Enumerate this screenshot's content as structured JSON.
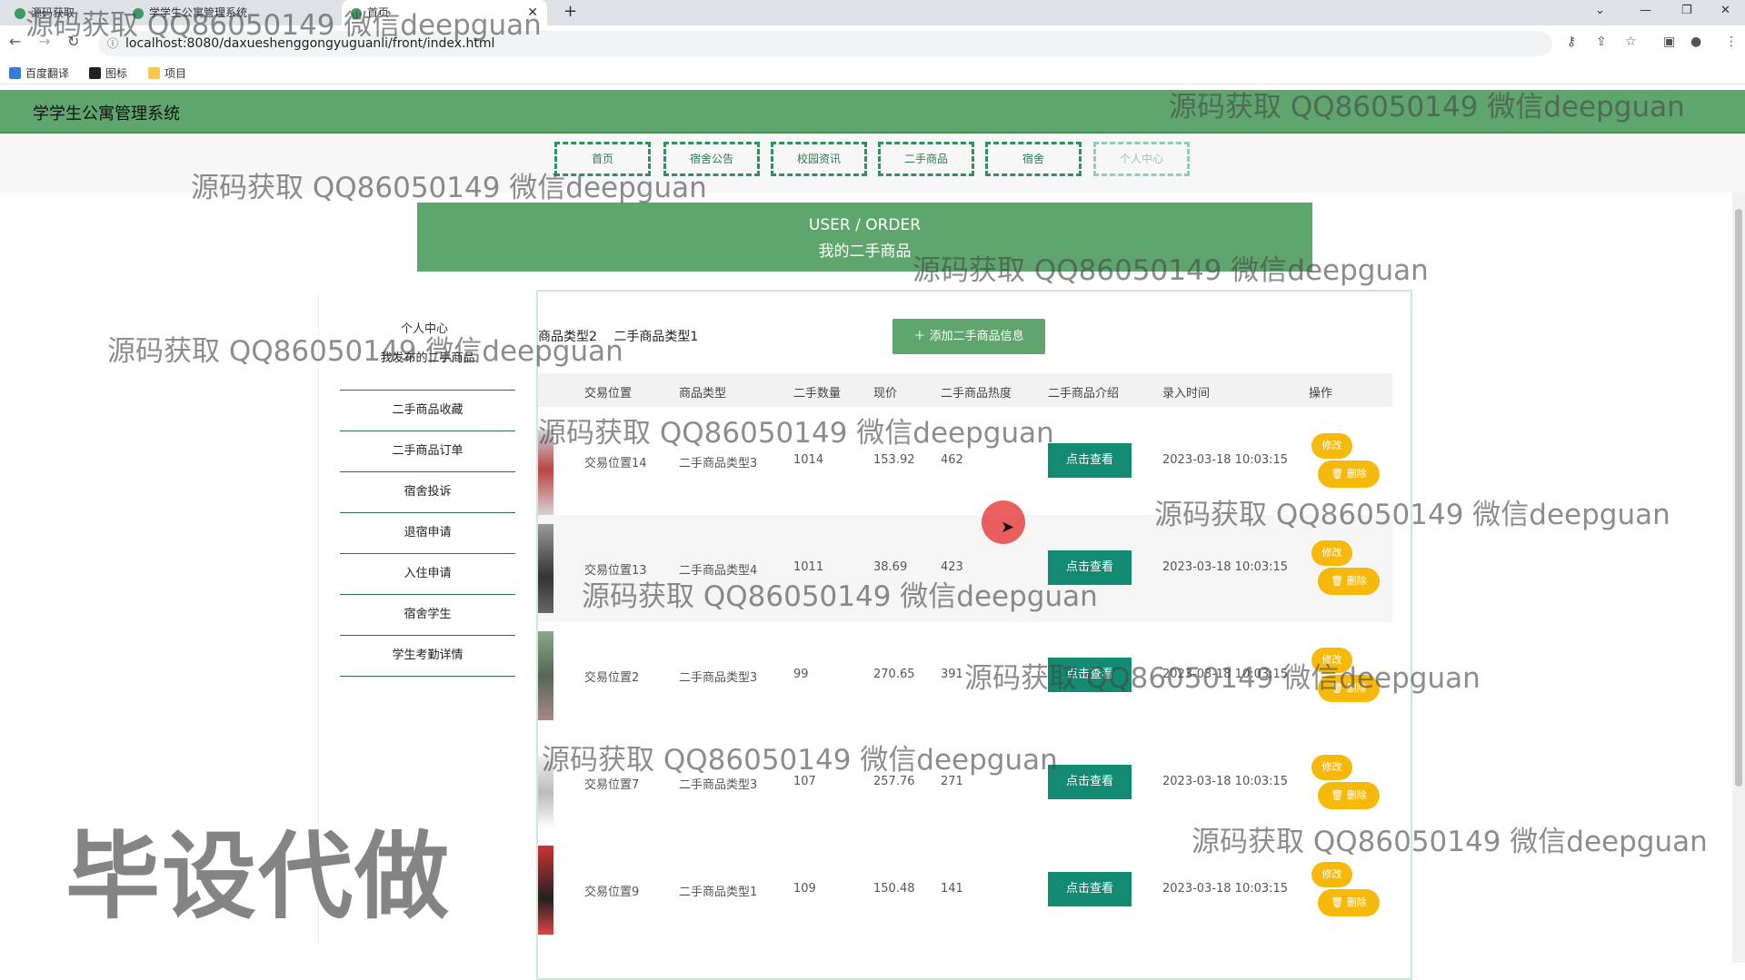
{
  "browser": {
    "tabs": [
      {
        "label": "源码获取 QQ86050149"
      },
      {
        "label": "学学生公寓管理系统"
      },
      {
        "label": "首页"
      }
    ],
    "url": "localhost:8080/daxueshenggongyuguanli/front/index.html",
    "bookmarks": [
      "百度翻译",
      "图标",
      "项目"
    ]
  },
  "site": {
    "title": "学学生公寓管理系统",
    "nav": [
      "首页",
      "宿舍公告",
      "校园资讯",
      "二手商品",
      "宿舍",
      "个人中心"
    ]
  },
  "banner": {
    "en": "USER / ORDER",
    "cn": "我的二手商品"
  },
  "sidebar": {
    "title": "个人中心",
    "items": [
      "我发布的二手商品",
      "二手商品收藏",
      "二手商品订单",
      "宿舍投诉",
      "退宿申请",
      "入住申请",
      "宿舍学生",
      "学生考勤详情"
    ]
  },
  "filters": {
    "type2": "商品类型2",
    "type1": "二手商品类型1"
  },
  "add_button": "添加二手商品信息",
  "table": {
    "headers": [
      "交易位置",
      "商品类型",
      "二手数量",
      "现价",
      "二手商品热度",
      "二手商品介绍",
      "录入时间",
      "操作"
    ],
    "rows": [
      {
        "location": "交易位置14",
        "type": "二手商品类型3",
        "qty": "1014",
        "price": "153.92",
        "heat": "462",
        "intro": "点击查看",
        "time": "2023-03-18 10:03:15",
        "edit": "修改",
        "del": "删除"
      },
      {
        "location": "交易位置13",
        "type": "二手商品类型4",
        "qty": "1011",
        "price": "38.69",
        "heat": "423",
        "intro": "点击查看",
        "time": "2023-03-18 10:03:15",
        "edit": "修改",
        "del": "删除"
      },
      {
        "location": "交易位置2",
        "type": "二手商品类型3",
        "qty": "99",
        "price": "270.65",
        "heat": "391",
        "intro": "点击查看",
        "time": "2023-03-18 10:03:15",
        "edit": "修改",
        "del": "删除"
      },
      {
        "location": "交易位置7",
        "type": "二手商品类型3",
        "qty": "107",
        "price": "257.76",
        "heat": "271",
        "intro": "点击查看",
        "time": "2023-03-18 10:03:15",
        "edit": "修改",
        "del": "删除"
      },
      {
        "location": "交易位置9",
        "type": "二手商品类型1",
        "qty": "109",
        "price": "150.48",
        "heat": "141",
        "intro": "点击查看",
        "time": "2023-03-18 10:03:15",
        "edit": "修改",
        "del": "删除"
      }
    ]
  },
  "watermark": {
    "text": "源码获取 QQ86050149 微信deepguan",
    "big": "毕设代做"
  },
  "colors": {
    "green": "#5fa56e",
    "teal": "#138a72",
    "yellow": "#f6b90a"
  }
}
